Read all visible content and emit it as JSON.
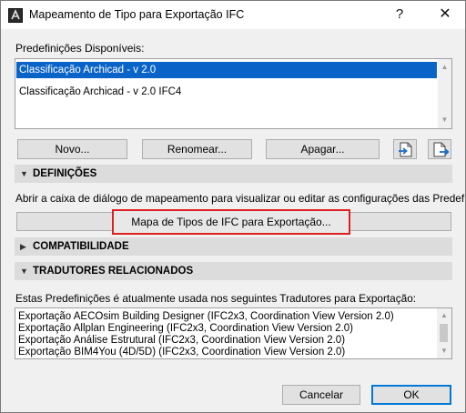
{
  "window": {
    "title": "Mapeamento de Tipo para Exportação IFC",
    "help_glyph": "?",
    "close_glyph": "✕"
  },
  "presets": {
    "label": "Predefinições Disponíveis:",
    "items": [
      {
        "label": "Classificação Archicad - v 2.0",
        "selected": true
      },
      {
        "label": "Classificação Archicad - v 2.0 IFC4",
        "selected": false
      }
    ]
  },
  "preset_buttons": {
    "new": "Novo...",
    "rename": "Renomear...",
    "delete": "Apagar...",
    "import_icon": "import-icon",
    "export_icon": "export-icon"
  },
  "sections": {
    "definitions": {
      "label": "DEFINIÇÕES",
      "expanded": true
    },
    "compatibility": {
      "label": "COMPATIBILIDADE",
      "expanded": false
    },
    "translators": {
      "label": "TRADUTORES RELACIONADOS",
      "expanded": true
    }
  },
  "definitions": {
    "description": "Abrir a caixa de diálogo de mapeamento para visualizar ou editar as configurações das Predef",
    "map_button": "Mapa de Tipos de IFC para Exportação..."
  },
  "translators": {
    "description": "Estas Predefinições é atualmente usada nos seguintes Tradutores para Exportação:",
    "items": [
      "Exportação AECOsim Building Designer (IFC2x3, Coordination View Version 2.0)",
      "Exportação Allplan Engineering (IFC2x3, Coordination View Version 2.0)",
      "Exportação Análise Estrutural (IFC2x3, Coordination View Version 2.0)",
      "Exportação BIM4You (4D/5D) (IFC2x3, Coordination View Version 2.0)"
    ]
  },
  "footer": {
    "cancel": "Cancelar",
    "ok": "OK"
  },
  "colors": {
    "selection": "#0a64c8",
    "section_header": "#dcdcdc",
    "highlight_border": "#e02020",
    "default_button_border": "#0078d7"
  }
}
